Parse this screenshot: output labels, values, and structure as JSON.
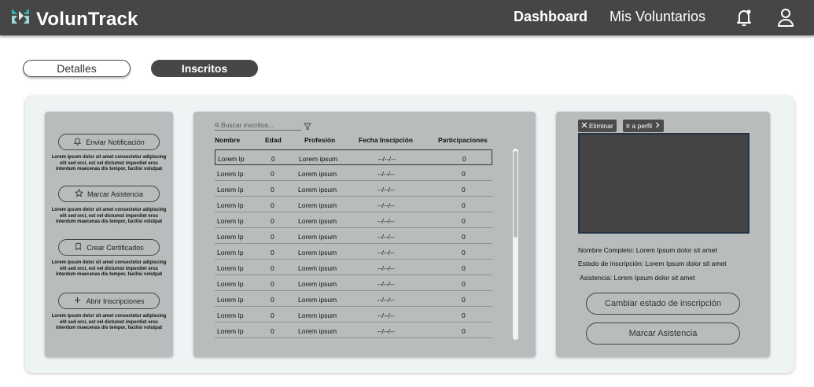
{
  "header": {
    "brand": "VolunTrack",
    "nav": {
      "dashboard": "Dashboard",
      "volunteers": "Mis Voluntarios"
    },
    "icons": {
      "logo": "voluntrack-logo-icon",
      "bell": "bell-icon",
      "user": "user-icon"
    }
  },
  "tabs": {
    "details": "Detalles",
    "enrolled": "Inscritos"
  },
  "actions": [
    {
      "label": "Enviar Notificación",
      "icon": "bell-icon",
      "desc": "Lorem ipsum dolor sit amet consectetur adipiscing elit sed orci, est vel dictumst imperdiet eros interdum maecenas dis tempor, facilisi volutpat"
    },
    {
      "label": "Marcar Asistencia",
      "icon": "star-icon",
      "desc": "Lorem ipsum dolor sit amet consectetur adipiscing elit sed orci, est vel dictumst imperdiet eros interdum maecenas dis tempor, facilisi volutpat"
    },
    {
      "label": "Crear Certificados",
      "icon": "bookmark-icon",
      "desc": "Lorem ipsum dolor sit amet consectetur adipiscing elit sed orci, est vel dictumst imperdiet eros interdum maecenas dis tempor, facilisi volutpat"
    },
    {
      "label": "Abrir Inscripciones",
      "icon": "plus-icon",
      "desc": "Lorem ipsum dolor sit amet consectetur adipiscing elit sed orci, est vel dictumst imperdiet eros interdum maecenas dis tempor, facilisi volutpat"
    }
  ],
  "table": {
    "search_placeholder": "Buscar inscritos...",
    "headers": [
      "Nombre",
      "Edad",
      "Profesión",
      "Fecha Inscipción",
      "Participaciones"
    ],
    "rows": [
      [
        "Lorem Ip",
        "0",
        "Lorem ipsum",
        "--/--/--",
        "0"
      ],
      [
        "Lorem Ip",
        "0",
        "Lorem ipsum",
        "--/--/--",
        "0"
      ],
      [
        "Lorem Ip",
        "0",
        "Lorem ipsum",
        "--/--/--",
        "0"
      ],
      [
        "Lorem Ip",
        "0",
        "Lorem ipsum",
        "--/--/--",
        "0"
      ],
      [
        "Lorem Ip",
        "0",
        "Lorem ipsum",
        "--/--/--",
        "0"
      ],
      [
        "Lorem Ip",
        "0",
        "Lorem ipsum",
        "--/--/--",
        "0"
      ],
      [
        "Lorem Ip",
        "0",
        "Lorem ipsum",
        "--/--/--",
        "0"
      ],
      [
        "Lorem Ip",
        "0",
        "Lorem ipsum",
        "--/--/--",
        "0"
      ],
      [
        "Lorem Ip",
        "0",
        "Lorem ipsum",
        "--/--/--",
        "0"
      ],
      [
        "Lorem Ip",
        "0",
        "Lorem ipsum",
        "--/--/--",
        "0"
      ],
      [
        "Lorem Ip",
        "0",
        "Lorem ipsum",
        "--/--/--",
        "0"
      ],
      [
        "Lorem Ip",
        "0",
        "Lorem ipsum",
        "--/--/--",
        "0"
      ]
    ]
  },
  "profile": {
    "delete_label": "Eliminar",
    "goto_label": "Ir a perfil",
    "full_name": "Nombre Completo: Lorem Ipsum dolor sit amet",
    "status": "Estado de inscripción: Lorem Ipsum dolor sit amet",
    "attendance": "Asistencia: Lorem Ipsum dolor sit amet",
    "change_status_button": "Cambiar estado de inscripción",
    "mark_attendance_button": "Marcar Asistencia"
  }
}
